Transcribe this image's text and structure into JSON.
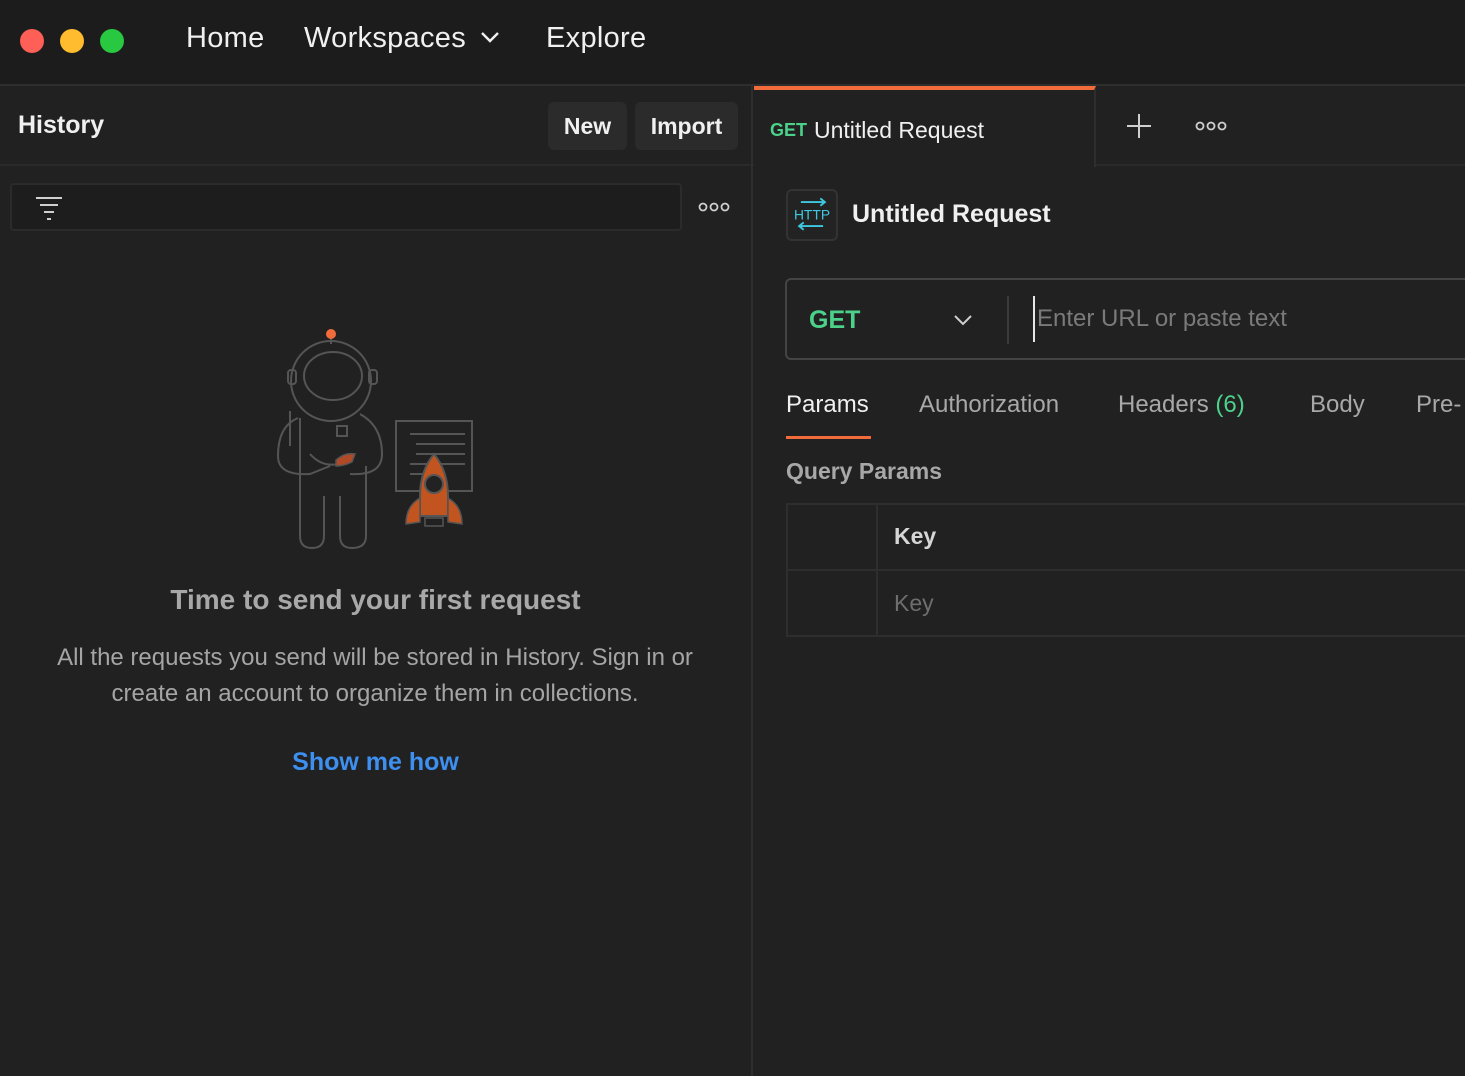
{
  "nav": {
    "home": "Home",
    "workspaces": "Workspaces",
    "explore": "Explore"
  },
  "sidebar": {
    "title": "History",
    "new_label": "New",
    "import_label": "Import",
    "empty_title": "Time to send your first request",
    "empty_desc": "All the requests you send will be stored in History. Sign in or create an account to organize them in collections.",
    "show_me": "Show me how"
  },
  "tab": {
    "method": "GET",
    "label": "Untitled Request"
  },
  "request": {
    "icon_text": "HTTP",
    "title": "Untitled Request",
    "method": "GET",
    "url_placeholder": "Enter URL or paste text"
  },
  "subtabs": {
    "params": "Params",
    "authorization": "Authorization",
    "headers": "Headers",
    "headers_count": "(6)",
    "body": "Body",
    "pre": "Pre-"
  },
  "query_params": {
    "label": "Query Params",
    "key_header": "Key",
    "key_placeholder": "Key"
  },
  "colors": {
    "accent": "#f26b3a",
    "method_green": "#4cd18b",
    "link_blue": "#3d8ff0"
  }
}
